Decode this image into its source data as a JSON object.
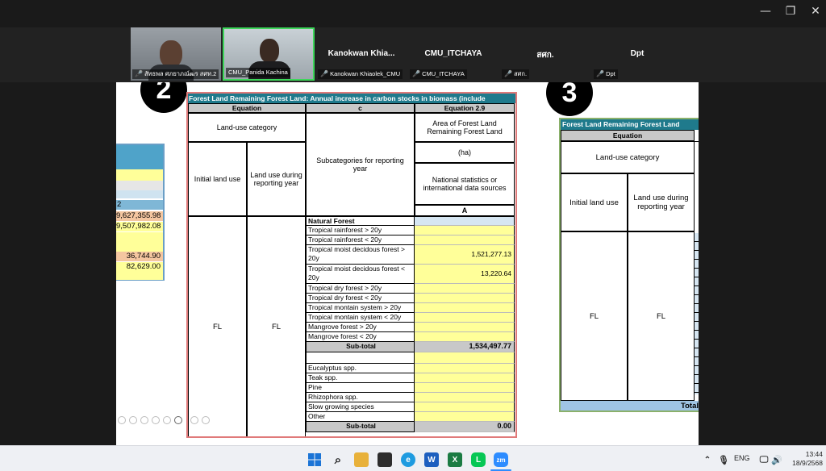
{
  "participants": {
    "video1": "สัทธพล ศภยาภณ์ฒร สศท.2",
    "video2": "CMU_Panida Kachina",
    "tiles": [
      {
        "name": "Kanokwan Khia...",
        "label": "Kanokwan Khiaolek_CMU"
      },
      {
        "name": "CMU_ITCHAYA",
        "label": "CMU_ITCHAYA"
      },
      {
        "name": "สศก.",
        "label": "สศก."
      },
      {
        "name": "Dpt",
        "label": "Dpt"
      }
    ]
  },
  "slide": {
    "num_left": "2",
    "num_right": "3",
    "left_values": [
      "9,627,355.98",
      "9,507,982.08",
      "36,744.90",
      "82,629.00"
    ],
    "left_row_label": "2",
    "title": "Forest Land Remaining Forest Land: Annual increase in carbon stocks in biomass (include",
    "equation_label": "Equation",
    "col_c": "c",
    "equation_ref": "Equation 2.9",
    "land_use_category": "Land-use category",
    "area_header": "Area of Forest Land Remaining Forest Land",
    "unit": "(ha)",
    "initial_land_use": "Initial land use",
    "land_use_reporting": "Land use during reporting year",
    "subcategories": "Subcategories for reporting year",
    "sources": "National statistics or international data sources",
    "col_a": "A",
    "fl1": "FL",
    "fl2": "FL",
    "natural_forest": "Natural Forest",
    "rows": [
      {
        "label": "Tropical rainforest > 20y",
        "value": ""
      },
      {
        "label": "Tropical rainforest < 20y",
        "value": ""
      },
      {
        "label": "Tropical moist decidous forest >",
        "label2": "20y",
        "value": "1,521,277.13"
      },
      {
        "label": "Tropical moist decidous forest <",
        "label2": "20y",
        "value": "13,220.64"
      },
      {
        "label": "Tropical dry forest > 20y",
        "value": ""
      },
      {
        "label": "Tropical dry forest < 20y",
        "value": ""
      },
      {
        "label": "Tropical montain system > 20y",
        "value": ""
      },
      {
        "label": "Tropical montain system < 20y",
        "value": ""
      },
      {
        "label": "Mangrove forest > 20y",
        "value": ""
      },
      {
        "label": "Mangrove forest < 20y",
        "value": ""
      }
    ],
    "subtotal_label": "Sub-total",
    "subtotal_value": "1,534,497.77",
    "plantation_rows": [
      "Eucalyptus spp.",
      "Teak spp.",
      "Pine",
      "Rhizophora spp.",
      "Slow growing species",
      "Other"
    ],
    "subtotal2_label": "Sub-total",
    "subtotal2_value": "0.00",
    "right_title": "Forest Land Remaining Forest Land",
    "right_equation": "Equation",
    "right_category": "Land-use category",
    "right_initial": "Initial land use",
    "right_reporting": "Land use during reporting year",
    "right_fl1": "FL",
    "right_fl2": "FL",
    "right_total": "Total"
  },
  "taskbar": {
    "lang": "ENG",
    "time": "13:44",
    "date": "18/9/2568"
  },
  "colors": {
    "header_teal": "#1f7a8c",
    "yellow": "#ffff99",
    "gray_header": "#c8c8c8"
  }
}
